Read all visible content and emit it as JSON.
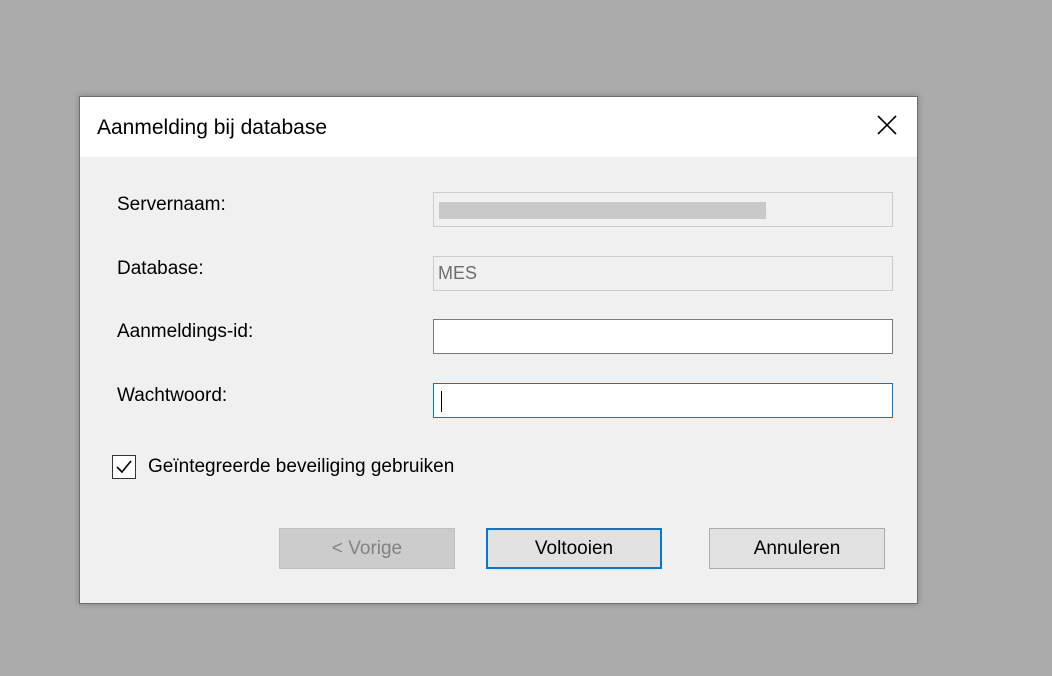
{
  "dialog": {
    "title": "Aanmelding bij database"
  },
  "form": {
    "server_label": "Servernaam:",
    "server_value": "",
    "database_label": "Database:",
    "database_value": "MES",
    "login_label": "Aanmeldings-id:",
    "login_value": "",
    "password_label": "Wachtwoord:",
    "password_value": ""
  },
  "options": {
    "integrated_security_label": "Geïntegreerde beveiliging gebruiken",
    "integrated_security_checked": true
  },
  "buttons": {
    "previous_label": "< Vorige",
    "finish_label": "Voltooien",
    "cancel_label": "Annuleren"
  },
  "colors": {
    "accent": "#0078d7",
    "backdrop": "#ababab",
    "dialog_bg": "#f0f0f0"
  },
  "icons": {
    "close": "close-icon",
    "check": "checkmark-icon"
  }
}
